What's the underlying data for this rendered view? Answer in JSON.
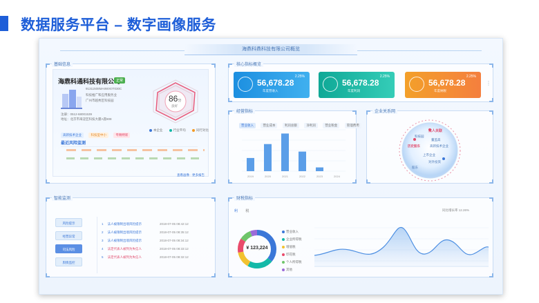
{
  "slide": {
    "title": "数据服务平台 – 数字画像服务",
    "accent": "#1e5ed8"
  },
  "dashboard": {
    "header": "海鼎科鼎科技有限公司概览"
  },
  "basic_info": {
    "panel_title": "基础信息",
    "company": "海鼎科通科技有限公司",
    "status": "正常",
    "lines": [
      "91311508MA8WX0T030C",
      "科技推广和应用服务业",
      "广州市越秀区科技园"
    ],
    "meta": [
      "注册：0512-68001539",
      "地址：北京市海淀区科技大厦A座808"
    ],
    "tags": [
      "高新技术企业",
      "科技型中小",
      "专精特新"
    ],
    "score": "86",
    "score_unit": "分",
    "score_sub": "良好",
    "score_legend": [
      "本企业",
      "行业平均",
      "同行对比"
    ],
    "section_title": "最近风险监测",
    "links": "查看画像 · 更多报告"
  },
  "kpis": {
    "panel_title": "核心指标概览",
    "items": [
      {
        "value": "56,678.28",
        "label": "年度营收入",
        "pct": "2.25%",
        "color": "#1c8fe0"
      },
      {
        "value": "56,678.28",
        "label": "年度利润",
        "pct": "2.25%",
        "color": "#14b9a8"
      },
      {
        "value": "56,678.28",
        "label": "年度纳税",
        "pct": "2.25%",
        "color": "#f39a24"
      }
    ],
    "more": "⋮"
  },
  "operations": {
    "panel_title": "经营指标",
    "tabs": [
      "营业收入",
      "营业成本",
      "利润总额",
      "净利润",
      "营业税金",
      "管理费用"
    ]
  },
  "chart_data": {
    "type": "bar",
    "title": "",
    "categories": [
      "2019",
      "2020",
      "2021",
      "2022",
      "2023",
      "2024"
    ],
    "values": [
      35,
      72,
      100,
      52,
      10,
      0
    ],
    "ylim": [
      0,
      110
    ],
    "color": "#5b9ee8"
  },
  "relations": {
    "panel_title": "企业关系网",
    "labels": [
      "法人关联",
      "科技园",
      "董监高",
      "高新技术企业",
      "上市企业",
      "对外投资",
      "股东",
      "历史股东"
    ],
    "center": "海鼎科通"
  },
  "monitor": {
    "panel_title": "智能监测",
    "buttons": [
      "风险提示",
      "经营异常",
      "司法风险",
      "舆情监控"
    ],
    "rows": [
      {
        "num": "1",
        "text": "法人被限制出境风险提示",
        "date": "2018-07-05 08:42:12",
        "color": "blue"
      },
      {
        "num": "2",
        "text": "法人被限制出境风险提示",
        "date": "2018-07-05 08:35:12",
        "color": "blue"
      },
      {
        "num": "3",
        "text": "法人被限制出境风险提示",
        "date": "2018-07-05 08:34:12",
        "color": "blue"
      },
      {
        "num": "4",
        "text": "法定代表人被列为失信人",
        "date": "2018-07-05 08:33:12",
        "color": "red"
      },
      {
        "num": "5",
        "text": "法定代表人被列为失信人",
        "date": "2018-07-05 08:32:12",
        "color": "red"
      }
    ]
  },
  "finance": {
    "panel_title": "财税指标",
    "tabs": [
      "利",
      "税"
    ],
    "note": "同比增长率 12.26%",
    "total": "¥ 123,224",
    "legend": [
      "营业收入",
      "企业所得税",
      "增值税",
      "印花税",
      "个人所得税",
      "其他"
    ],
    "colors": [
      "#3b77d8",
      "#14b9a8",
      "#f2c230",
      "#e94b6b",
      "#6fc56a",
      "#9b6ad8"
    ]
  }
}
